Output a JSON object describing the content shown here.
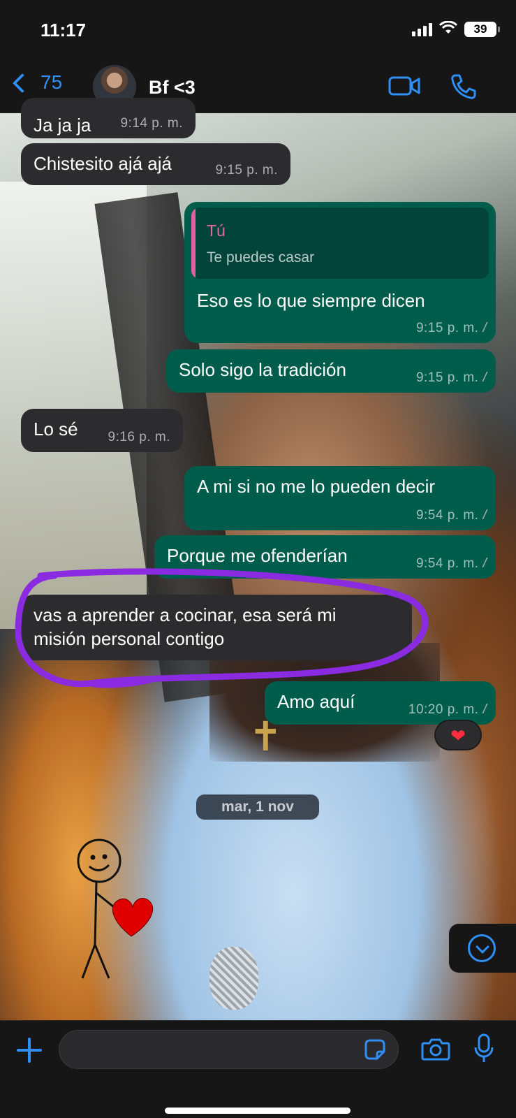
{
  "status_bar": {
    "time": "11:17",
    "battery": "39"
  },
  "header": {
    "back_count": "75",
    "contact_name": "Bf <3"
  },
  "messages": [
    {
      "direction": "in",
      "text": "Ja ja ja",
      "time": "9:14 p. m."
    },
    {
      "direction": "in",
      "text": "Chistesito ajá ajá",
      "time": "9:15 p. m."
    },
    {
      "direction": "out",
      "quote_author": "Tú",
      "quote_text": "Te puedes casar",
      "text": "Eso es lo que siempre dicen",
      "time": "9:15 p. m."
    },
    {
      "direction": "out",
      "text": "Solo sigo la tradición",
      "time": "9:15 p. m."
    },
    {
      "direction": "in",
      "text": "Lo sé",
      "time": "9:16 p. m."
    },
    {
      "direction": "out",
      "text": "A mi si no me lo pueden decir",
      "time": "9:54 p. m."
    },
    {
      "direction": "out",
      "text": "Porque me ofenderían",
      "time": "9:54 p. m."
    },
    {
      "direction": "in",
      "text_line1": "vas a aprender a cocinar, esa será mi",
      "text_line2": "misión personal contigo"
    },
    {
      "direction": "out",
      "text": "Amo aquí",
      "time": "10:20 p. m.",
      "reaction": "❤"
    }
  ],
  "date_separator": "mar, 1 nov",
  "composer": {
    "placeholder": ""
  },
  "colors": {
    "accent": "#2f8ff6",
    "incoming_bubble": "#2c2c2e",
    "outgoing_bubble": "#005c4b",
    "highlight_scribble": "#8a2be2",
    "quote_author": "#e06aa8"
  },
  "icons": [
    "back-chevron-icon",
    "video-call-icon",
    "phone-call-icon",
    "scroll-down-icon",
    "plus-icon",
    "sticker-icon",
    "camera-icon",
    "microphone-icon",
    "read-ticks-icon",
    "heart-reaction-icon"
  ]
}
